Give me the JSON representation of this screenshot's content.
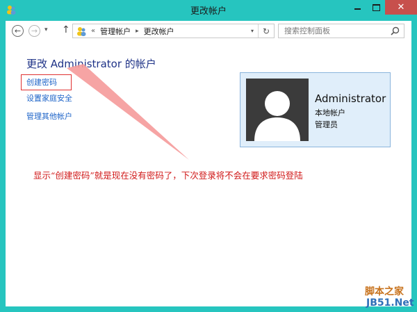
{
  "window": {
    "title": "更改帐户",
    "close_glyph": "✕"
  },
  "nav": {
    "back_glyph": "←",
    "forward_glyph": "→",
    "recent_glyph": "▾",
    "up_glyph": "↑"
  },
  "address": {
    "chevron": "«",
    "segments": [
      "管理帐户",
      "更改帐户"
    ],
    "separator": "▸",
    "dropdown_glyph": "▾",
    "refresh_glyph": "↻"
  },
  "search": {
    "placeholder": "搜索控制面板"
  },
  "main": {
    "heading": "更改 Administrator 的帐户",
    "links": {
      "create_password": "创建密码",
      "family_safety": "设置家庭安全",
      "manage_other": "管理其他帐户"
    }
  },
  "account": {
    "name": "Administrator",
    "type": "本地帐户",
    "role": "管理员"
  },
  "annotation": {
    "text": "显示“创建密码”就是现在没有密码了，下次登录将不会在要求密码登陆"
  },
  "watermark": {
    "line1": "脚本之家",
    "line2": "JB51.Net"
  },
  "colors": {
    "frame": "#26c5bf",
    "close_button": "#c7504c",
    "link": "#1e64c8",
    "heading": "#1e3287",
    "annotation": "#d01818",
    "arrow": "#f59a9a",
    "card_bg": "#e0eefa"
  },
  "icons": {
    "app": "users-icon",
    "address": "users-icon",
    "search": "magnifier-icon"
  }
}
